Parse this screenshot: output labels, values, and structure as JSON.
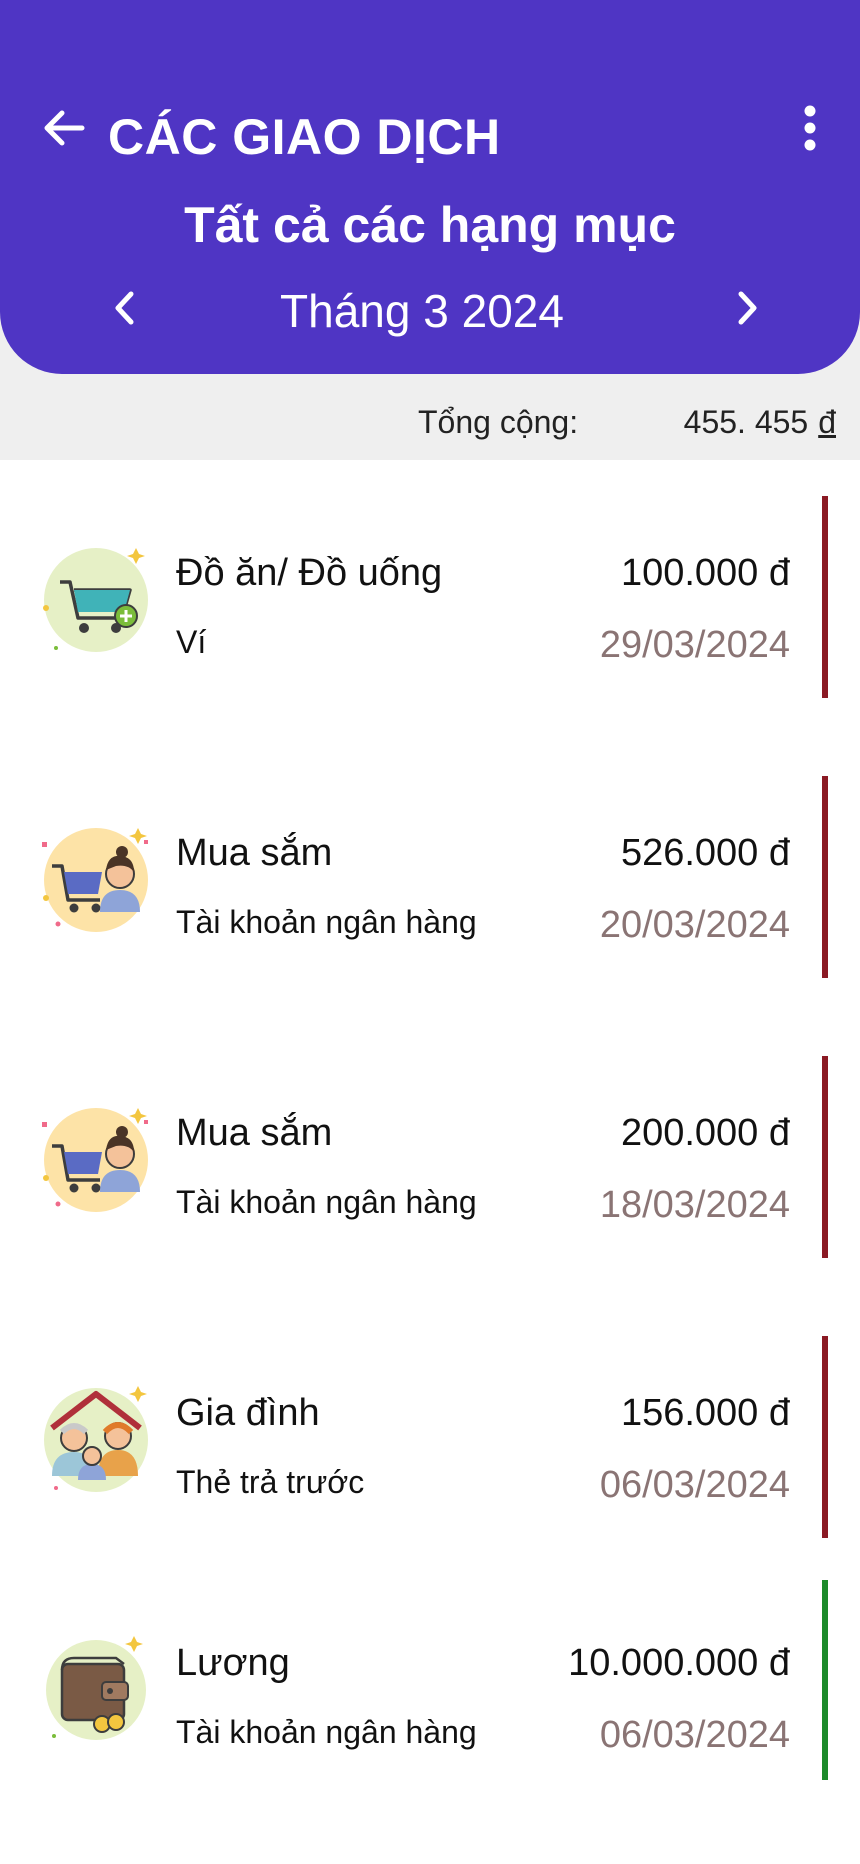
{
  "header": {
    "title": "CÁC GIAO DỊCH",
    "subtitle": "Tất cả các hạng mục",
    "month": "Tháng 3 2024",
    "back_icon": "arrow-left-icon",
    "more_icon": "more-vertical-icon",
    "prev_icon": "chevron-left-icon",
    "next_icon": "chevron-right-icon",
    "background": "#4f35c4"
  },
  "summary": {
    "label": "Tổng cộng:",
    "value": "455. 455",
    "currency": "đ"
  },
  "transactions": [
    {
      "category": "Đồ ăn/ Đồ uống",
      "account": "Ví",
      "amount": "100.000 đ",
      "date": "29/03/2024",
      "type": "expense",
      "icon": "shopping-cart-icon"
    },
    {
      "category": "Mua sắm",
      "account": "Tài khoản ngân hàng",
      "amount": "526.000 đ",
      "date": "20/03/2024",
      "type": "expense",
      "icon": "shopper-icon"
    },
    {
      "category": "Mua sắm",
      "account": "Tài khoản ngân hàng",
      "amount": "200.000 đ",
      "date": "18/03/2024",
      "type": "expense",
      "icon": "shopper-icon"
    },
    {
      "category": "Gia đình",
      "account": "Thẻ trả trước",
      "amount": "156.000 đ",
      "date": "06/03/2024",
      "type": "expense",
      "icon": "family-icon"
    },
    {
      "category": "Lương",
      "account": "Tài khoản ngân hàng",
      "amount": "10.000.000 đ",
      "date": "06/03/2024",
      "type": "income",
      "icon": "wallet-icon"
    }
  ],
  "colors": {
    "expense": "#8b1a24",
    "income": "#1d8a2a",
    "date_text": "#8a7474"
  }
}
